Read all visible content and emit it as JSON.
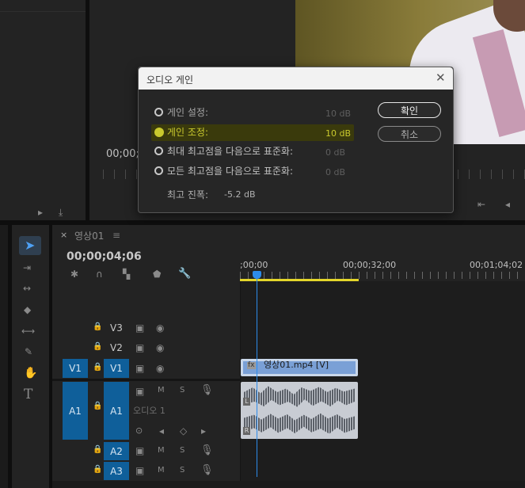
{
  "source_monitor": {
    "timecode": "00;00;"
  },
  "dialog": {
    "title": "오디오 게인",
    "options": [
      {
        "label": "게인 설정:",
        "value": "10 dB",
        "selected": false
      },
      {
        "label": "게인 조정:",
        "value": "10 dB",
        "selected": true
      },
      {
        "label": "최대 최고점을 다음으로 표준화:",
        "value": "0 dB",
        "selected": false
      },
      {
        "label": "모든 최고점을 다음으로 표준화:",
        "value": "0 dB",
        "selected": false
      }
    ],
    "peak_label": "최고 진폭:",
    "peak_value": "-5.2 dB",
    "ok_label": "확인",
    "cancel_label": "취소"
  },
  "timeline": {
    "tab_title": "영상01",
    "timecode": "00;00;04;06",
    "ruler_labels": [
      ";00;00",
      "00;00;32;00",
      "00;01;04;02"
    ],
    "tracks_video": [
      {
        "name": "V3",
        "source": ""
      },
      {
        "name": "V2",
        "source": ""
      },
      {
        "name": "V1",
        "source": "V1"
      }
    ],
    "tracks_audio": [
      {
        "name": "A1",
        "source": "A1",
        "sub": "오디오 1"
      },
      {
        "name": "A2",
        "source": ""
      },
      {
        "name": "A3",
        "source": ""
      }
    ],
    "video_clip_label": "영상01.mp4 [V]",
    "track_letters": {
      "mute": "M",
      "solo": "S"
    },
    "audio_channel_markers": [
      "L",
      "R"
    ],
    "playhead_symbol": "⊙"
  },
  "colors": {
    "accent": "#2d8ceb",
    "selection_blue": "#0f5f9a",
    "clip_video": "#7aa0d6",
    "clip_audio": "#c8ccd3",
    "highlight": "#3a3a0c",
    "highlight_text": "#c9c92e"
  }
}
